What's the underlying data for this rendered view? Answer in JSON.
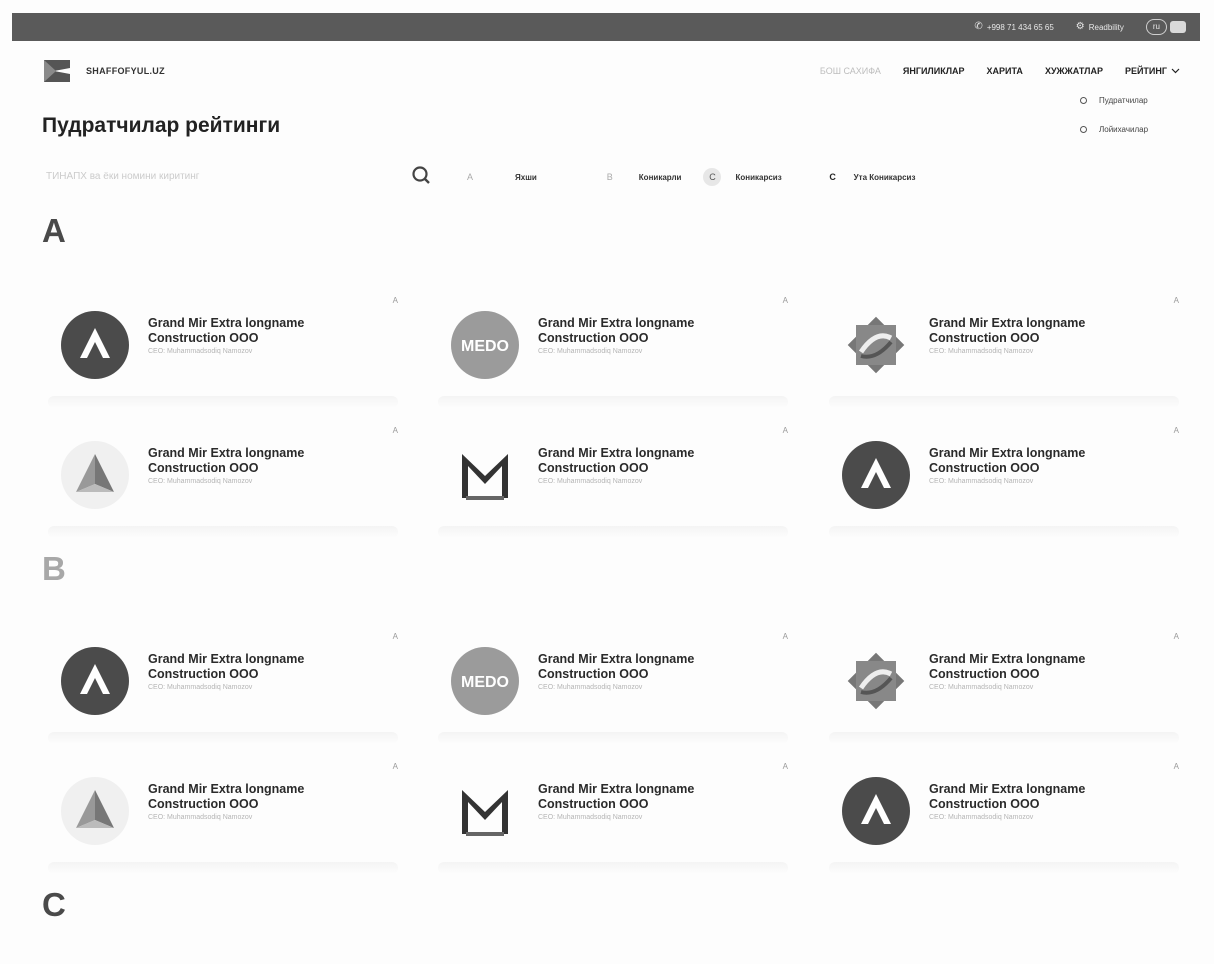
{
  "topbar": {
    "phone": "+998 71 434 65 65",
    "readability": "Readbility",
    "lang": "ru"
  },
  "header": {
    "brand": "SHAFFOFYUL.UZ",
    "nav": [
      "БОШ САХИФА",
      "ЯНГИЛИКЛАР",
      "ХАРИТА",
      "ХУЖЖАТЛАР",
      "РЕЙТИНГ"
    ],
    "dropdown": [
      "Пудратчилар",
      "Лойихачилар"
    ]
  },
  "page": {
    "title": "Пудратчилар рейтинги",
    "search_placeholder": "ТИНАПХ ва ёки номини киритинг"
  },
  "filters": [
    {
      "badge": "A",
      "label": "Яхши"
    },
    {
      "badge": "B",
      "label": "Коникарли"
    },
    {
      "badge": "C",
      "label": "Коникарсиз"
    },
    {
      "badge": "C",
      "label": "Ута Коникарсиз"
    }
  ],
  "sections": [
    {
      "letter": "A",
      "cards": [
        {
          "name": "Grand Mir Extra longname Construction OOO",
          "ceo": "CEO: Muhammadsodiq Namozov",
          "grade": "A",
          "logo": "circle-a-logo"
        },
        {
          "name": "Grand Mir Extra longname Construction OOO",
          "ceo": "CEO: Muhammadsodiq Namozov",
          "grade": "A",
          "logo": "medo-logo"
        },
        {
          "name": "Grand Mir Extra longname Construction OOO",
          "ceo": "CEO: Muhammadsodiq Namozov",
          "grade": "A",
          "logo": "octagon-logo"
        },
        {
          "name": "Grand Mir Extra longname Construction OOO",
          "ceo": "CEO: Muhammadsodiq Namozov",
          "grade": "A",
          "logo": "triangle-logo"
        },
        {
          "name": "Grand Mir Extra longname Construction OOO",
          "ceo": "CEO: Muhammadsodiq Namozov",
          "grade": "A",
          "logo": "m-logo"
        },
        {
          "name": "Grand Mir Extra longname Construction OOO",
          "ceo": "CEO: Muhammadsodiq Namozov",
          "grade": "A",
          "logo": "circle-a-logo"
        }
      ]
    },
    {
      "letter": "B",
      "cards": [
        {
          "name": "Grand Mir Extra longname Construction OOO",
          "ceo": "CEO: Muhammadsodiq Namozov",
          "grade": "A",
          "logo": "circle-a-logo"
        },
        {
          "name": "Grand Mir Extra longname Construction OOO",
          "ceo": "CEO: Muhammadsodiq Namozov",
          "grade": "A",
          "logo": "medo-logo"
        },
        {
          "name": "Grand Mir Extra longname Construction OOO",
          "ceo": "CEO: Muhammadsodiq Namozov",
          "grade": "A",
          "logo": "octagon-logo"
        },
        {
          "name": "Grand Mir Extra longname Construction OOO",
          "ceo": "CEO: Muhammadsodiq Namozov",
          "grade": "A",
          "logo": "triangle-logo"
        },
        {
          "name": "Grand Mir Extra longname Construction OOO",
          "ceo": "CEO: Muhammadsodiq Namozov",
          "grade": "A",
          "logo": "m-logo"
        },
        {
          "name": "Grand Mir Extra longname Construction OOO",
          "ceo": "CEO: Muhammadsodiq Namozov",
          "grade": "A",
          "logo": "circle-a-logo"
        }
      ]
    },
    {
      "letter": "C",
      "cards": []
    }
  ],
  "colors": {
    "topbar": "#5a5a5a",
    "logo_dark": "#4b4b4b",
    "medo": "#9b9b9b"
  }
}
